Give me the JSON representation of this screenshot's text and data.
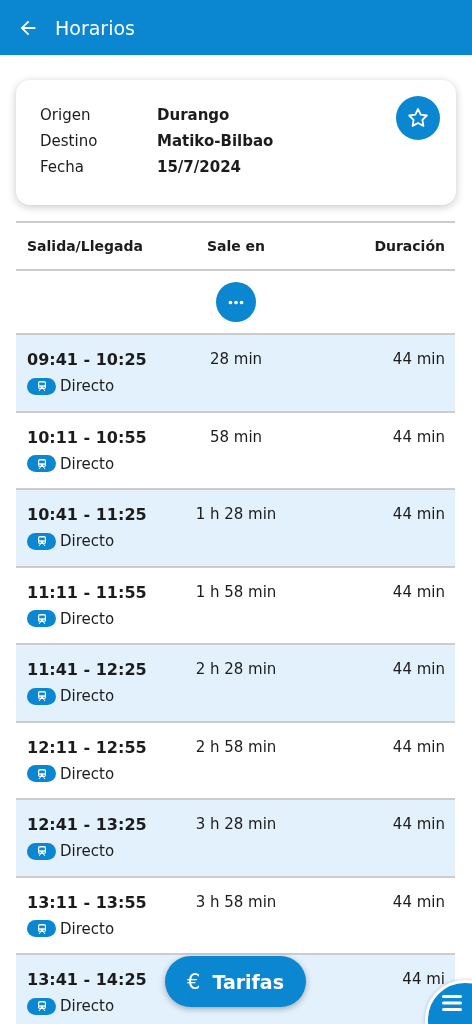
{
  "app_bar": {
    "title": "Horarios"
  },
  "trip": {
    "fields": [
      {
        "label": "Origen",
        "value": "Durango"
      },
      {
        "label": "Destino",
        "value": "Matiko-Bilbao"
      },
      {
        "label": "Fecha",
        "value": "15/7/2024"
      }
    ],
    "favorite": false
  },
  "table": {
    "columns": [
      "Salida/Llegada",
      "Sale en",
      "Duración"
    ],
    "rows": [
      {
        "times": "09:41 - 10:25",
        "type": "Directo",
        "departs_in": "28 min",
        "duration": "44 min"
      },
      {
        "times": "10:11 - 10:55",
        "type": "Directo",
        "departs_in": "58 min",
        "duration": "44 min"
      },
      {
        "times": "10:41 - 11:25",
        "type": "Directo",
        "departs_in": "1 h 28 min",
        "duration": "44 min"
      },
      {
        "times": "11:11 - 11:55",
        "type": "Directo",
        "departs_in": "1 h 58 min",
        "duration": "44 min"
      },
      {
        "times": "11:41 - 12:25",
        "type": "Directo",
        "departs_in": "2 h 28 min",
        "duration": "44 min"
      },
      {
        "times": "12:11 - 12:55",
        "type": "Directo",
        "departs_in": "2 h 58 min",
        "duration": "44 min"
      },
      {
        "times": "12:41 - 13:25",
        "type": "Directo",
        "departs_in": "3 h 28 min",
        "duration": "44 min"
      },
      {
        "times": "13:11 - 13:55",
        "type": "Directo",
        "departs_in": "3 h 58 min",
        "duration": "44 min"
      },
      {
        "times": "13:41 - 14:25",
        "type": "Directo",
        "duration": "44 mi"
      }
    ]
  },
  "fares_button": {
    "icon": "€",
    "label": "Tarifas"
  }
}
